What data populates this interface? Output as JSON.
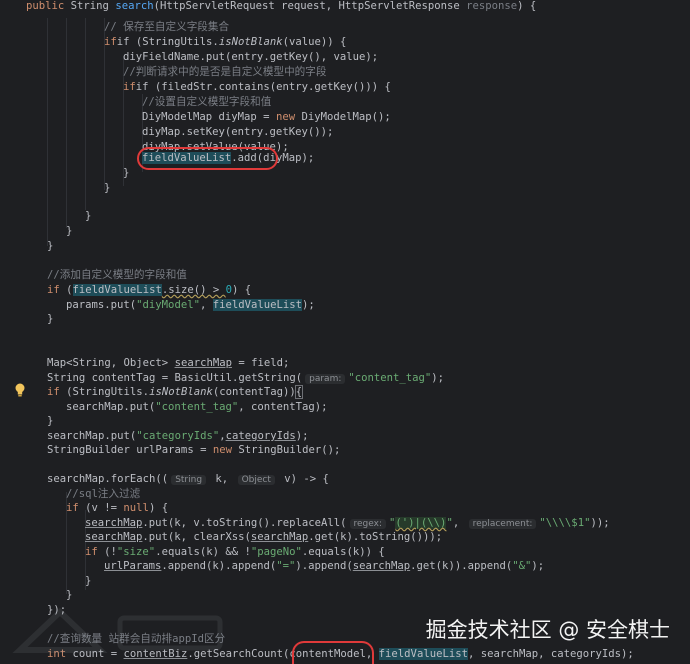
{
  "lines": {
    "l1": {
      "kw": "public",
      "t1": " String ",
      "fn": "search",
      "t2": "(HttpServletRequest request, HttpServletResponse ",
      "p": "response",
      "t3": ") {"
    },
    "l2": {
      "cmt": "// 保存至自定义字段集合"
    },
    "l3": {
      "t1": "if (StringUtils.",
      "it": "isNotBlank",
      "t2": "(value)) {"
    },
    "l4": {
      "t1": "diyFieldName.put(entry.getKey(), value);"
    },
    "l5": {
      "cmt": "//判断请求中的是否是自定义模型中的字段"
    },
    "l6": {
      "t1": "if (filedStr.contains(entry.getKey())) {"
    },
    "l7": {
      "cmt": "//设置自定义模型字段和值"
    },
    "l8": {
      "t1": "DiyModelMap diyMap = ",
      "kw": "new",
      "t2": " DiyModelMap();"
    },
    "l9": {
      "t1": "diyMap.setKey(entry.getKey());"
    },
    "l10": {
      "t1": "diyMap.setValue(value);"
    },
    "l11": {
      "hl": "fieldValueList",
      "t1": ".add(diyMap);"
    },
    "l12": {
      "t1": "}"
    },
    "l13": {
      "t1": "}"
    },
    "l14": {
      "t1": "}"
    },
    "l15": {
      "t1": "}"
    },
    "l16": {
      "t1": "}"
    },
    "l17": {
      "cmt": "//添加自定义模型的字段和值"
    },
    "l18": {
      "kw": "if",
      "t1": " (",
      "hl": "fieldValueList",
      "t2": ".size() > ",
      "num": "0",
      "t3": ") {"
    },
    "l19": {
      "t1": "params.put(",
      "str": "\"diyModel\"",
      "t2": ", ",
      "hl": "fieldValueList",
      "t3": ");"
    },
    "l20": {
      "t1": "}"
    },
    "l21": {
      "t1": "Map<String, Object> ",
      "ul": "searchMap",
      "t2": " = field;"
    },
    "l22": {
      "t1": "String contentTag = BasicUtil.getString(",
      "hint": "param:",
      "str": "\"content_tag\"",
      "t2": ");"
    },
    "l23": {
      "kw": "if",
      "t1": " (StringUtils.",
      "it": "isNotBlank",
      "t2": "(contentTag))",
      "t3": "{"
    },
    "l24": {
      "t1": "searchMap.put(",
      "str": "\"content_tag\"",
      "t2": ", contentTag);"
    },
    "l25": {
      "t1": "}"
    },
    "l26": {
      "t1": "searchMap.put(",
      "str": "\"categoryIds\"",
      "t2": ",",
      "ul": "categoryIds",
      "t3": ");"
    },
    "l27": {
      "t1": "StringBuilder urlParams = ",
      "kw": "new",
      "t2": " StringBuilder();"
    },
    "l28": {
      "t1": "searchMap.forEach((",
      "hint1": "String",
      "t2": " k, ",
      "hint2": "Object",
      "t3": " v) -> {"
    },
    "l29": {
      "cmt": "//sql注入过滤"
    },
    "l30": {
      "kw": "if",
      "t1": " (v != ",
      "kw2": "null",
      "t2": ") {"
    },
    "l31": {
      "ul": "searchMap",
      "t1": ".put(k, v.toString().replaceAll(",
      "hint1": "regex:",
      "str1": "\"",
      "hlstr": "(')|(\\\\)",
      "str2": "\"",
      "t2": ", ",
      "hint2": "replacement:",
      "str3": "\"\\\\\\\\$1\"",
      "t3": "));"
    },
    "l32": {
      "ul": "searchMap",
      "t1": ".put(k, clearXss(",
      "ul2": "searchMap",
      "t2": ".get(k).toString()));"
    },
    "l33": {
      "kw": "if",
      "t1": " (!",
      "str1": "\"size\"",
      "t2": ".equals(k) && !",
      "str2": "\"pageNo\"",
      "t3": ".equals(k)) {"
    },
    "l34": {
      "ul": "urlParams",
      "t1": ".append(k).append(",
      "str1": "\"=\"",
      "t2": ").append(",
      "ul2": "searchMap",
      "t3": ".get(k)).append(",
      "str2": "\"&\"",
      "t4": ");"
    },
    "l35": {
      "t1": "}"
    },
    "l36": {
      "t1": "}"
    },
    "l37": {
      "t1": "});"
    },
    "l38": {
      "cmt": "//查询数量 站群会自动排appId区分"
    },
    "l39": {
      "kw": "int",
      "t1": " count = ",
      "ul": "contentBiz",
      "t2": ".getSearchCount(contentModel, ",
      "hl": "fieldValueList",
      "t3": ", searchMap, categoryIds);"
    }
  },
  "watermark": "掘金技术社区 @ 安全棋士",
  "colors": {
    "background": "#1e1f22",
    "keyword": "#cf8e6d",
    "function": "#56a8f5",
    "string": "#6aab73",
    "comment": "#7a7e85",
    "highlight": "#1e4d59",
    "annotation": "#e03a3a"
  }
}
